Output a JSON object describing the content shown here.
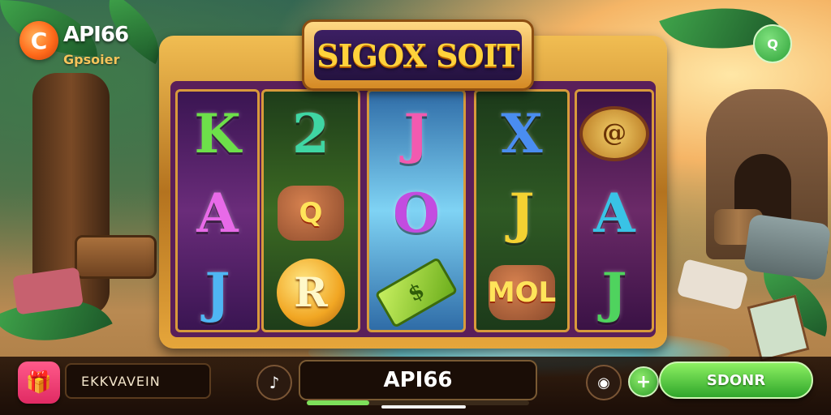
{
  "brand": {
    "name": "API66",
    "subtitle": "Gpsoier",
    "logo_icon": "C"
  },
  "game_title": "SIGOX SOIT",
  "top_right_button": {
    "icon": "app-icon",
    "label": "Q"
  },
  "reels": [
    {
      "colors": [
        "#3a1552",
        "#6a2c7a"
      ],
      "symbols": [
        {
          "type": "letter",
          "text": "K",
          "color": "#6de04a"
        },
        {
          "type": "letter",
          "text": "A",
          "color": "#e86ae8"
        },
        {
          "type": "letter",
          "text": "J",
          "color": "#4fb6f3"
        }
      ]
    },
    {
      "colors": [
        "#1e3d1a",
        "#3c6a23"
      ],
      "symbols": [
        {
          "type": "letter",
          "text": "2",
          "color": "#3fd6a3"
        },
        {
          "type": "shield",
          "text": "Q"
        },
        {
          "type": "coin",
          "text": "R"
        }
      ]
    },
    {
      "colors": [
        "#2f6ca7",
        "#7fd3f4"
      ],
      "symbols": [
        {
          "type": "letter",
          "text": "J",
          "color": "#f25ab0"
        },
        {
          "type": "letter",
          "text": "O",
          "color": "#c34ce0"
        },
        {
          "type": "bill",
          "text": "$"
        }
      ]
    },
    {
      "colors": [
        "#1c3a1a",
        "#2f5a24"
      ],
      "symbols": [
        {
          "type": "letter",
          "text": "X",
          "color": "#4a8df0"
        },
        {
          "type": "letter",
          "text": "J",
          "color": "#f4d232"
        },
        {
          "type": "shield",
          "text": "MOL"
        }
      ]
    },
    {
      "colors": [
        "#3a1245",
        "#6b2a68"
      ],
      "symbols": [
        {
          "type": "scroll",
          "text": "@"
        },
        {
          "type": "letter",
          "text": "A",
          "color": "#39c3e6"
        },
        {
          "type": "letter",
          "text": "J",
          "color": "#4fd35e"
        }
      ]
    }
  ],
  "bottom_bar": {
    "gift_icon": "gift-icon",
    "info_text": "EKKVAVEIN",
    "sound_icon": "speaker-icon",
    "main_text": "API66",
    "progress_fraction": 0.28,
    "camera_icon": "camera-icon",
    "plus_label": "+",
    "spin_label": "SDONR"
  }
}
